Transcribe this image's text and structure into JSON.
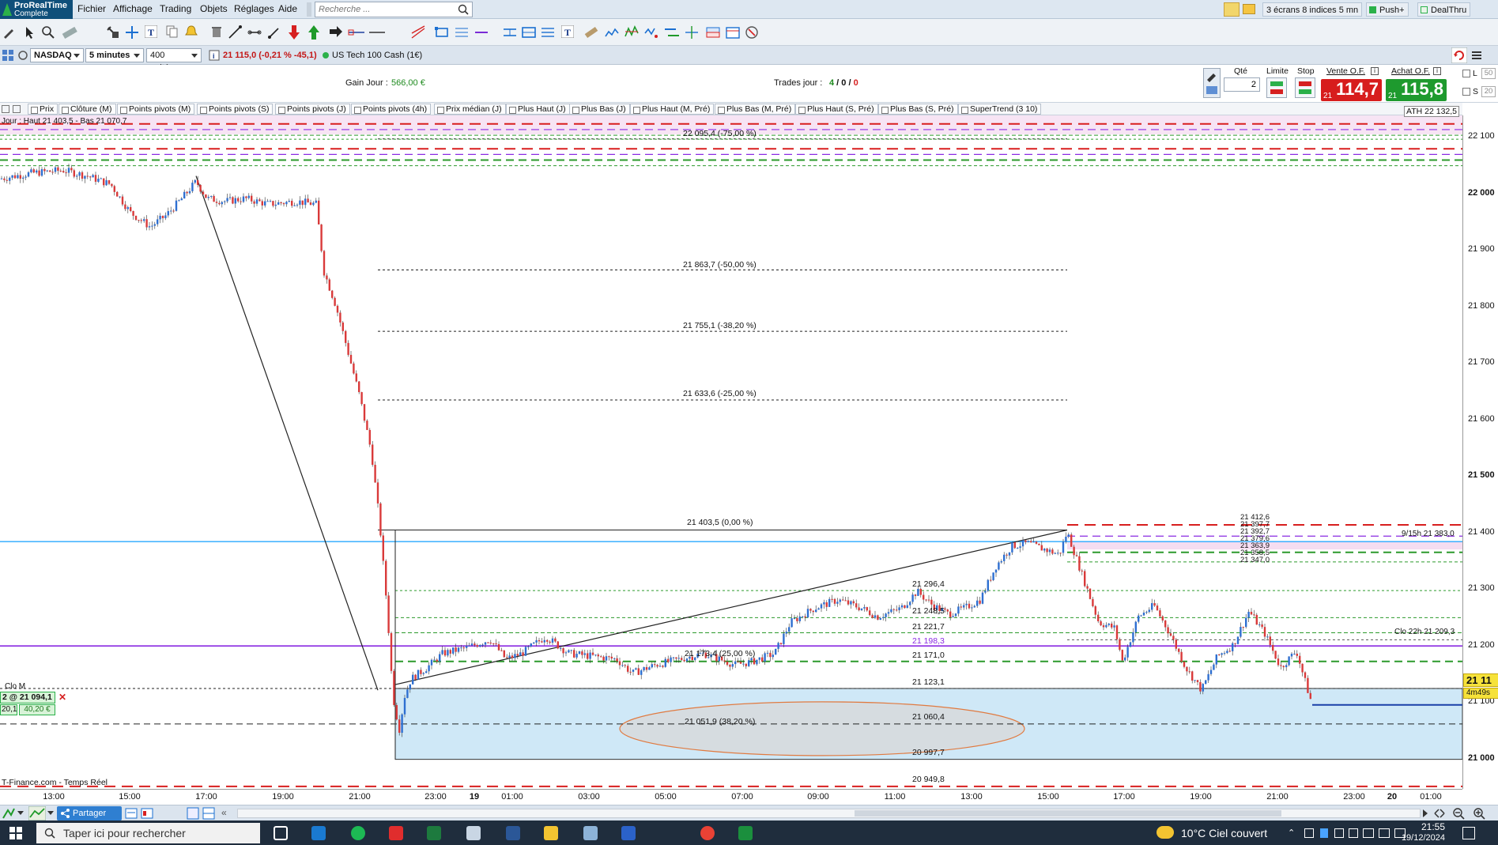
{
  "app": {
    "logo_line1": "ProRealTime",
    "logo_line2": "Complete",
    "menus": [
      "Fichier",
      "Affichage",
      "Trading",
      "Objets",
      "Réglages",
      "Aide"
    ],
    "search_placeholder": "Recherche ...",
    "workspace": "3 écrans 8 indices 5 mn",
    "push_label": "Push+",
    "dealthru_label": "DealThru"
  },
  "instrument": {
    "market": "NASDAQ",
    "timeframe": "5 minutes",
    "units": "400 unités",
    "quote": "21 115,0 (-0,21 % -45,1)",
    "name": "US Tech 100 Cash (1€)"
  },
  "info": {
    "gain_label": "Gain Jour :",
    "gain_value": "566,00 €",
    "trades_label": "Trades jour :",
    "trades_a": "4",
    "trades_b": "0",
    "trades_c": "0",
    "qty_label": "Qté",
    "qty_value": "2",
    "limit_label": "Limite",
    "stop_label": "Stop",
    "sell_label": "Vente O.F.",
    "buy_label": "Achat O.F.",
    "sell_price": "114,7",
    "buy_price": "115,8",
    "sell_prefix": "21",
    "buy_prefix": "21",
    "opt_l": "L",
    "opt_s": "S",
    "opt_l_val": "50",
    "opt_s_val": "20"
  },
  "indicators": [
    "Prix",
    "Clôture (M)",
    "Points pivots (M)",
    "Points pivots (S)",
    "Points pivots (J)",
    "Points pivots (4h)",
    "Prix médian (J)",
    "Plus Haut (J)",
    "Plus Bas (J)",
    "Plus Haut (M, Pré)",
    "Plus Bas (M, Pré)",
    "Plus Haut (S, Pré)",
    "Plus Bas (S, Pré)",
    "SuperTrend (3 10)"
  ],
  "chart_labels": {
    "top_left": "Jour : Haut 21 403,5 - Bas 21 070,7",
    "fib_top": "22 095,4 (-75,00 %)",
    "fib_50": "21 863,7 (-50,00 %)",
    "fib_382": "21 755,1 (-38,20 %)",
    "fib_25": "21 633,6 (-25,00 %)",
    "fib_0": "21 403,5 (0,00 %)",
    "fib_25b": "21 173,4 (25,00 %)",
    "fib_382b": "21 051,9 (38,20 %)",
    "lvl_2964": "21 296,4",
    "lvl_2485": "21 248,5",
    "lvl_2217": "21 221,7",
    "lvl_1983": "21 198,3",
    "lvl_1710": "21 171,0",
    "lvl_1231": "21 123,1",
    "lvl_0604": "21 060,4",
    "lvl_9977": "20 997,7",
    "lvl_9498": "20 949,8",
    "ath": "ATH 22 132,5",
    "h915": "9/15h 21 383,0",
    "clo22": "Clo 22h 21 209,3",
    "clo_m": "Clo M",
    "position": "2 @ 21 094,1",
    "pos_a": "20,1",
    "pos_b": "40,20 €",
    "right_stack": [
      "21 412,6",
      "21 397,7",
      "21 392,7",
      "21 379,6",
      "21 363,9",
      "21 358,5",
      "21 347,0"
    ],
    "price_box": "21 11",
    "countdown": "4m49s",
    "source": "T-Finance.com - Temps Réel"
  },
  "y_ticks": [
    "22 100",
    "22 000",
    "21 900",
    "21 800",
    "21 700",
    "21 600",
    "21 500",
    "21 400",
    "21 300",
    "21 200",
    "21 100",
    "21 000"
  ],
  "x_ticks": [
    "13:00",
    "15:00",
    "17:00",
    "19:00",
    "21:00",
    "23:00",
    "19",
    "01:00",
    "03:00",
    "05:00",
    "07:00",
    "09:00",
    "11:00",
    "13:00",
    "15:00",
    "17:00",
    "19:00",
    "21:00",
    "23:00",
    "20",
    "01:00"
  ],
  "bottom": {
    "share_label": "Partager"
  },
  "taskbar": {
    "search_text": "Taper ici pour rechercher",
    "weather": "10°C  Ciel couvert",
    "time": "21:55",
    "date": "19/12/2024"
  },
  "colors": {
    "bull": "#2e6fd1",
    "bear": "#d93a3a",
    "red_dash": "#d81e1e",
    "green_dash": "#2c9a2c",
    "purple": "#8a2be2",
    "cyan": "#2aa9ff",
    "zone_fill": "#cfe8f7"
  }
}
